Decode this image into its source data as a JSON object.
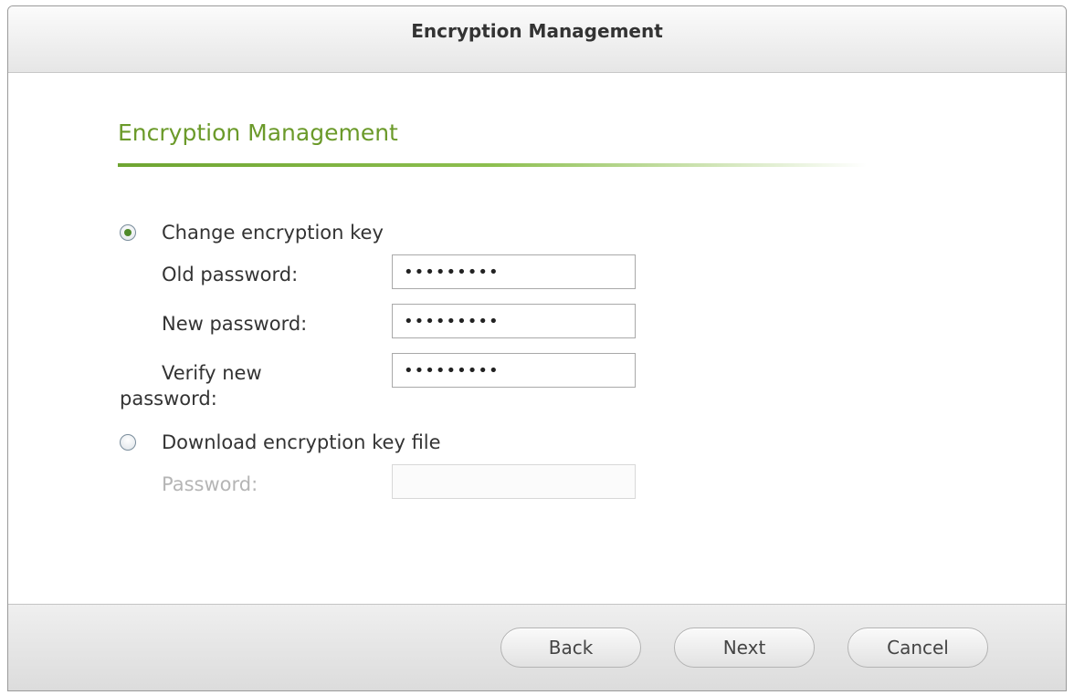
{
  "dialog": {
    "title": "Encryption Management",
    "section_title": "Encryption Management",
    "accent_color": "#6b9a2a"
  },
  "options": {
    "change_key": {
      "label": "Change encryption key",
      "selected": true
    },
    "download_key": {
      "label": "Download encryption key file",
      "selected": false
    }
  },
  "fields": {
    "old_password": {
      "label": "Old password:",
      "value": "•••••••••"
    },
    "new_password": {
      "label": "New password:",
      "value": "•••••••••"
    },
    "verify_password": {
      "label_line1": "Verify new",
      "label_line2": "password:",
      "value": "•••••••••"
    },
    "download_password": {
      "label": "Password:",
      "value": "",
      "disabled": true
    }
  },
  "buttons": {
    "back": "Back",
    "next": "Next",
    "cancel": "Cancel"
  }
}
